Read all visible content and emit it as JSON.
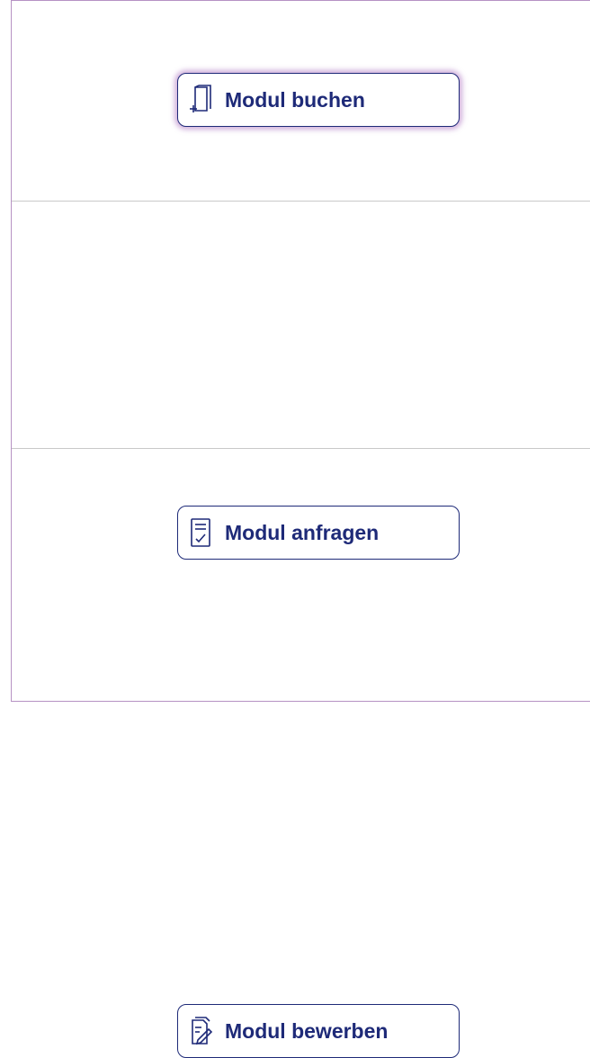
{
  "colors": {
    "accent": "#1e2a78",
    "frame_border": "#b692c4",
    "divider": "#c9c9c9",
    "focus_glow": "#aa6ebe"
  },
  "actions": [
    {
      "label": "Modul buchen",
      "icon": "book-add-icon",
      "focused": true
    },
    {
      "label": "Modul anfragen",
      "icon": "checklist-document-icon",
      "focused": false
    },
    {
      "label": "Modul bewerben",
      "icon": "document-edit-icon",
      "focused": false
    }
  ]
}
